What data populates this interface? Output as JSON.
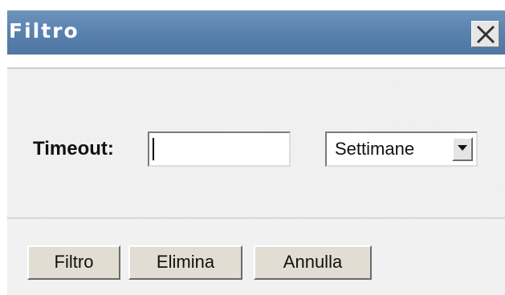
{
  "dialog": {
    "title": "Filtro",
    "close_icon": "close-icon"
  },
  "form": {
    "timeout_label": "Timeout:",
    "timeout_value": "",
    "unit_selected": "Settimane",
    "dropdown_icon": "dropdown-arrow-icon"
  },
  "buttons": {
    "filter_label": "Filtro",
    "delete_label": "Elimina",
    "cancel_label": "Annulla"
  }
}
